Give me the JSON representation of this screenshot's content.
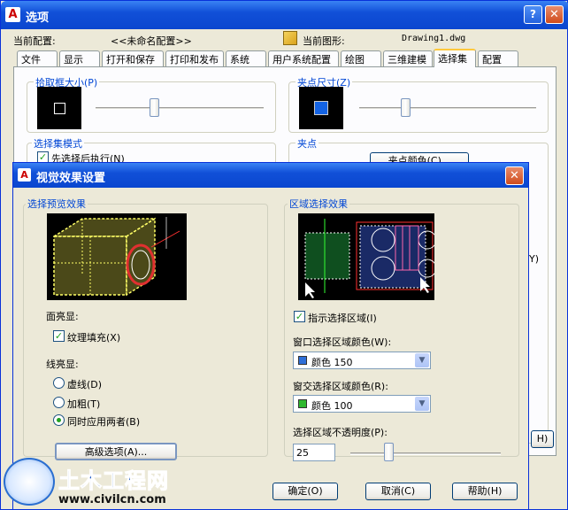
{
  "outer": {
    "title": "选项",
    "help": "?",
    "close": "✕",
    "current_profile_label": "当前配置:",
    "current_profile_value": "<<未命名配置>>",
    "current_drawing_label": "当前图形:",
    "current_drawing_value": "Drawing1.dwg",
    "tabs": [
      "文件",
      "显示",
      "打开和保存",
      "打印和发布",
      "系统",
      "用户系统配置",
      "绘图",
      "三维建模",
      "选择集",
      "配置"
    ],
    "active_tab": "选择集",
    "pickbox_size": "拾取框大小(P)",
    "grip_size": "夹点尺寸(Z)",
    "selection_modes": "选择集模式",
    "noun_verb": "先选择后执行(N)",
    "grips": "夹点",
    "grip_colors_button": "夹点颜色(C)...",
    "side_frag": "Y)",
    "side_btn_frag": "H)"
  },
  "dialog": {
    "title": "视觉效果设置",
    "close": "✕",
    "preview_group": "选择预览效果",
    "face_highlight": "面亮显:",
    "texture_fill": "纹理填充(X)",
    "line_highlight": "线亮显:",
    "radio_dash": "虚线(D)",
    "radio_thicken": "加粗(T)",
    "radio_both": "同时应用两者(B)",
    "advanced_button": "高级选项(A)...",
    "area_group": "区域选择效果",
    "indicate_area": "指示选择区域(I)",
    "window_color_label": "窗口选择区域颜色(W):",
    "window_color_value": "颜色 150",
    "crossing_color_label": "窗交选择区域颜色(R):",
    "crossing_color_value": "颜色 100",
    "opacity_label": "选择区域不透明度(P):",
    "opacity_value": "25",
    "ok": "确定(O)",
    "cancel": "取消(C)",
    "help": "帮助(H)"
  },
  "watermark": {
    "brand": "土木工程网",
    "url": "www.civilcn.com"
  },
  "colors": {
    "window_color": "#2e6fd8",
    "crossing_color": "#2fb82f",
    "grip_blue": "#1463e3"
  },
  "sliders": {
    "pickbox_level": 0.5,
    "grip_level": 0.3,
    "opacity_fraction": 0.25
  }
}
